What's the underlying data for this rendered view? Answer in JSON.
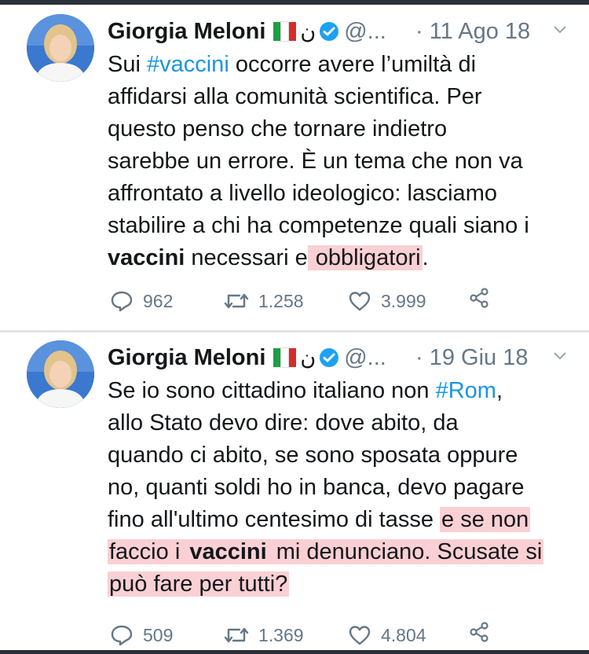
{
  "tweets": [
    {
      "author": {
        "name": "Giorgia Meloni",
        "handle": "@...",
        "extra_glyph": "ن"
      },
      "date": "· 11 Ago 18",
      "lines": [
        [
          {
            "t": "Sui "
          },
          {
            "t": "#vaccini",
            "s": "hashtag"
          },
          {
            "t": " occorre avere l’umiltà di"
          }
        ],
        [
          {
            "t": "affidarsi alla comunità scientifica. Per"
          }
        ],
        [
          {
            "t": "questo penso che tornare indietro"
          }
        ],
        [
          {
            "t": "sarebbe un errore. È un tema che non va"
          }
        ],
        [
          {
            "t": "affrontato a livello ideologico: lasciamo"
          }
        ],
        [
          {
            "t": "stabilire a chi ha competenze quali siano i"
          }
        ],
        [
          {
            "t": "vaccini",
            "s": "bold"
          },
          {
            "t": " necessari e"
          },
          {
            "t": " obbligatori",
            "s": "hl"
          },
          {
            "t": "."
          }
        ]
      ],
      "stats": {
        "replies": "962",
        "retweets": "1.258",
        "likes": "3.999"
      }
    },
    {
      "author": {
        "name": "Giorgia Meloni",
        "handle": "@...",
        "extra_glyph": "ن"
      },
      "date": "· 19 Giu 18",
      "lines": [
        [
          {
            "t": "Se io sono cittadino italiano non "
          },
          {
            "t": "#Rom",
            "s": "hashtag"
          },
          {
            "t": ","
          }
        ],
        [
          {
            "t": "allo Stato devo dire: dove abito, da"
          }
        ],
        [
          {
            "t": "quando ci abito, se sono sposata oppure"
          }
        ],
        [
          {
            "t": "no, quanti soldi ho in banca, devo pagare"
          }
        ],
        [
          {
            "t": "fino all'ultimo centesimo di tasse "
          },
          {
            "t": "e se non",
            "s": "hl"
          }
        ],
        [
          {
            "t": "faccio i ",
            "s": "hl"
          },
          {
            "t": "vaccini",
            "s": "hl bold"
          },
          {
            "t": " mi denunciano. Scusate si",
            "s": "hl"
          }
        ],
        [
          {
            "t": "può fare per tutti?",
            "s": "hl"
          }
        ]
      ],
      "stats": {
        "replies": "509",
        "retweets": "1.369",
        "likes": "4.804"
      }
    }
  ],
  "colors": {
    "hashtag": "#1b95e0",
    "muted": "#657786",
    "verified": "#1da1f2",
    "highlight": "#f496a0"
  },
  "icons": [
    "reply-icon",
    "retweet-icon",
    "like-icon",
    "share-icon",
    "verified-icon",
    "chevron-down-icon",
    "italy-flag-icon"
  ]
}
